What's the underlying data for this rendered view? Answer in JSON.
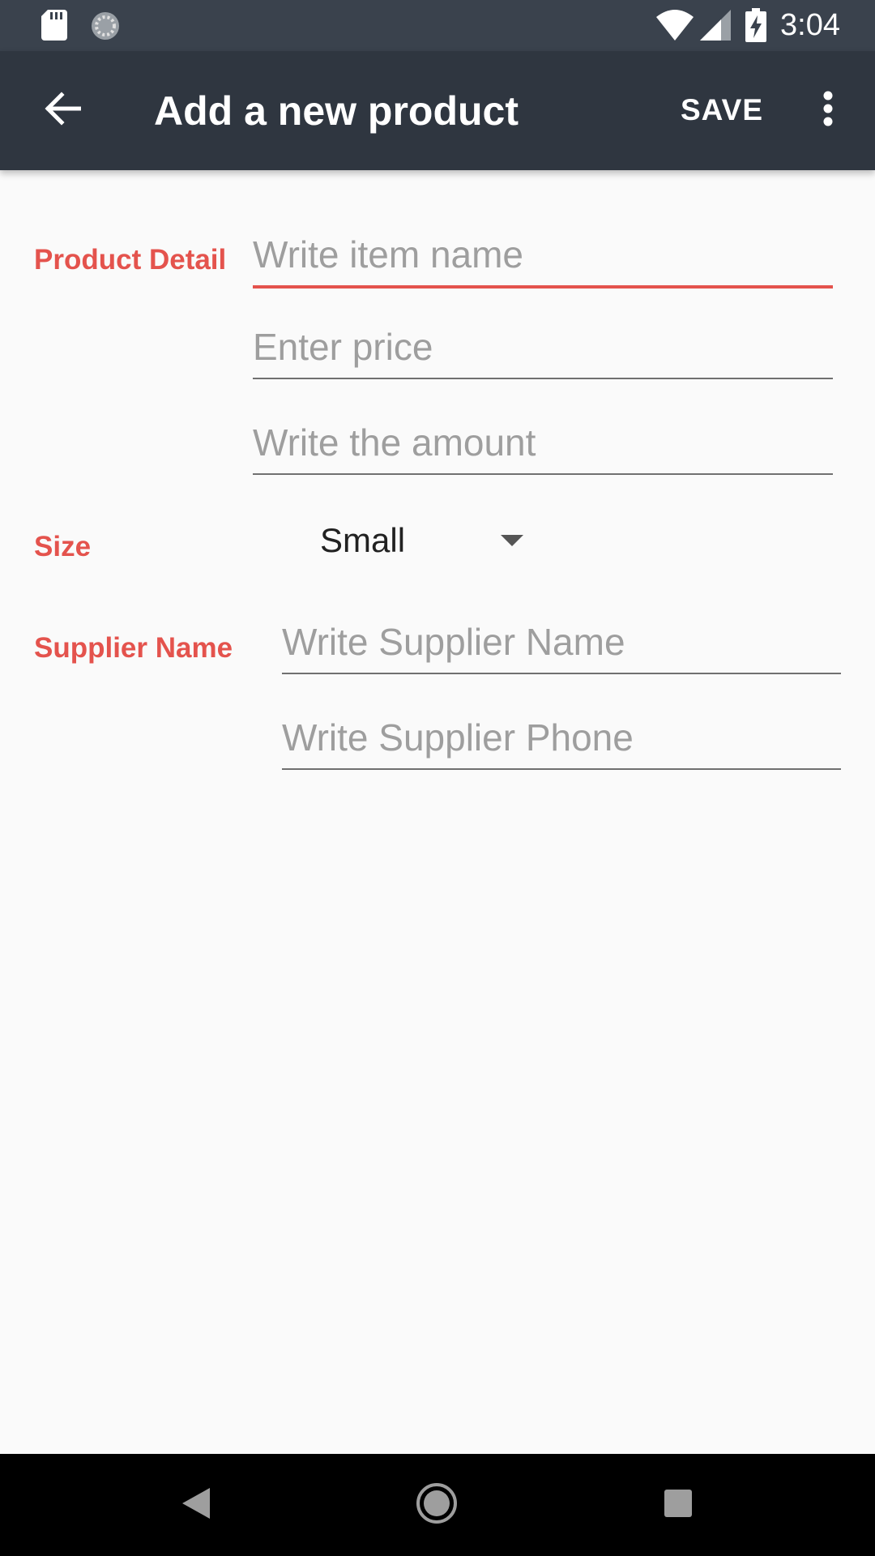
{
  "status_bar": {
    "time": "3:04",
    "icons": [
      "sd-card-icon",
      "sync-icon",
      "wifi-icon",
      "signal-icon",
      "battery-charging-icon"
    ]
  },
  "app_bar": {
    "title": "Add a new product",
    "save_label": "SAVE",
    "back_icon": "arrow-back-icon",
    "overflow_icon": "more-vert-icon"
  },
  "form": {
    "product_detail_label": "Product Detail",
    "item_name_placeholder": "Write item name",
    "price_placeholder": "Enter price",
    "amount_placeholder": "Write the amount",
    "size_label": "Size",
    "size_selected": "Small",
    "supplier_label": "Supplier Name",
    "supplier_name_placeholder": "Write Supplier Name",
    "supplier_phone_placeholder": "Write Supplier Phone"
  },
  "nav_bar": {
    "icons": [
      "nav-back-icon",
      "nav-home-icon",
      "nav-recents-icon"
    ]
  },
  "colors": {
    "accent": "#e4534d",
    "app_bar": "#2f3640",
    "status_bar": "#3a424d",
    "background": "#fafafa"
  }
}
